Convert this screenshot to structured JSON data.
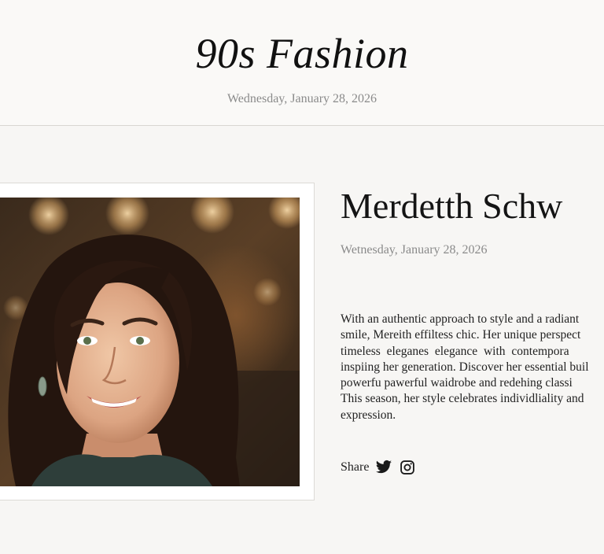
{
  "site": {
    "title": "90s Fashion",
    "date": "Wednesday, January 28, 2026"
  },
  "article": {
    "title": "Merdetth Schw",
    "date": "Wetnesday, January 28, 2026",
    "body_lines": [
      "With an authentic approach to style and a radiant",
      "smile, Mereith effiltess chic. Her unique perspect",
      "timeless eleganes elegance with contempora",
      "inspiing her generation. Discover her essential buil",
      "powerfu pawerful waidrobe and redehing classi",
      "This season, her style celebrates individliality and",
      "expression."
    ],
    "share_label": "Share",
    "share_icons": [
      "twitter-icon",
      "instagram-icon"
    ]
  },
  "colors": {
    "background": "#f7f6f4",
    "text": "#1b1b1b",
    "muted": "#8a8a8a",
    "rule": "#d8d6d2"
  }
}
